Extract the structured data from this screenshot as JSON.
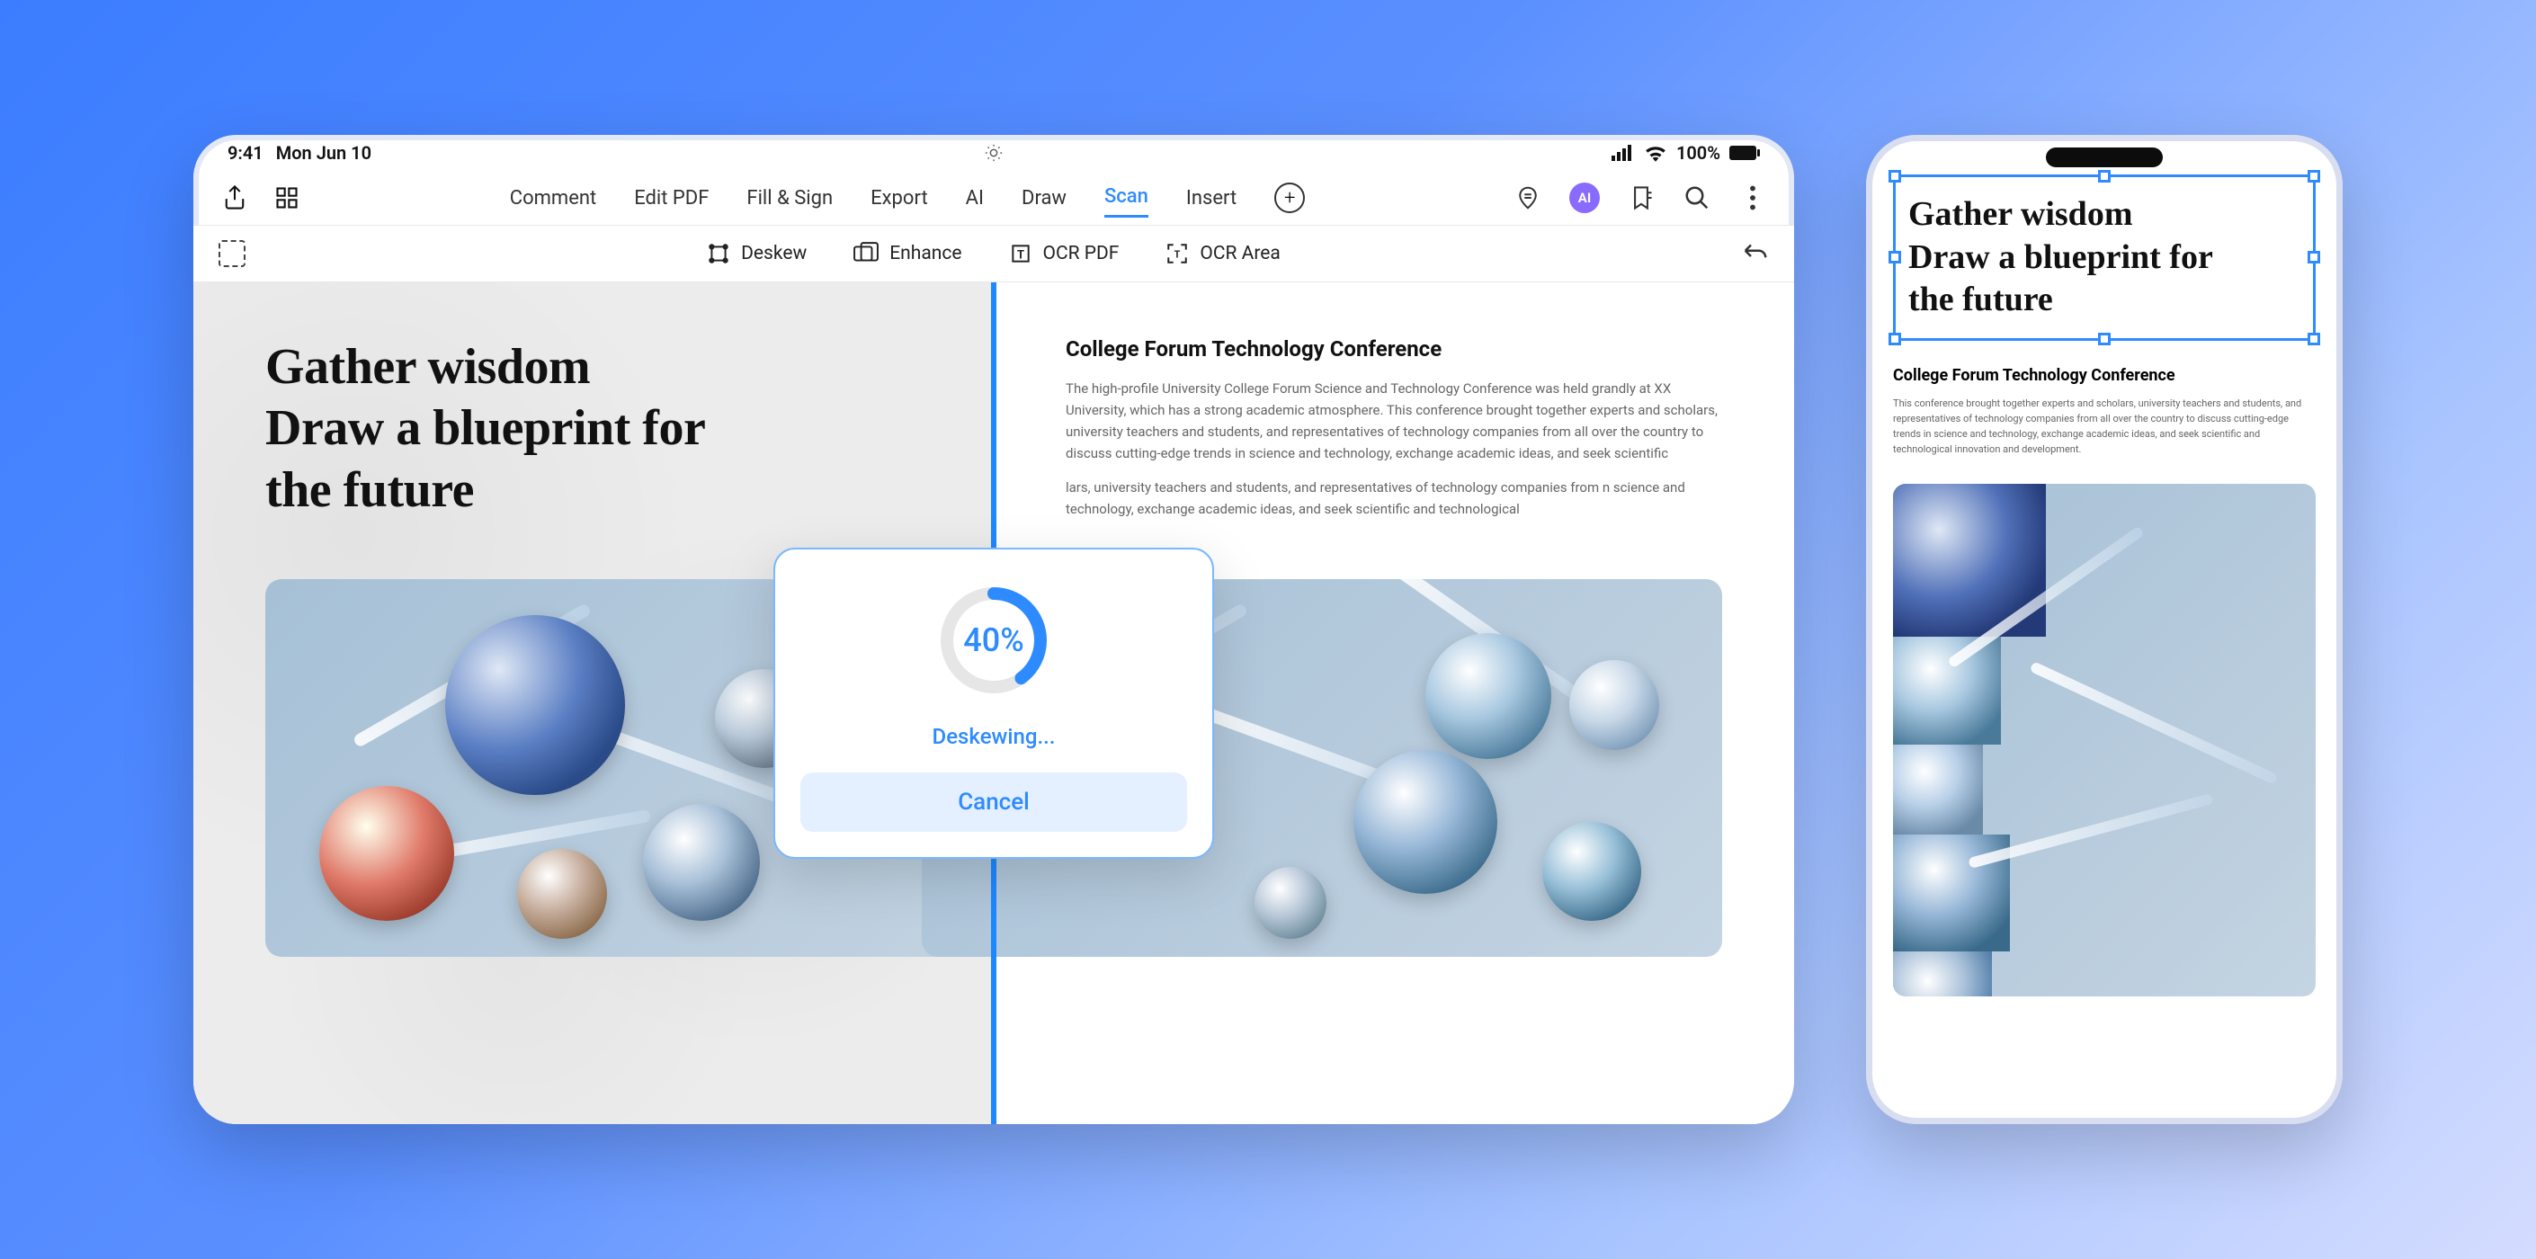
{
  "status_bar": {
    "time": "9:41",
    "date": "Mon Jun 10",
    "battery": "100%"
  },
  "toolbar": {
    "tabs": [
      "Comment",
      "Edit PDF",
      "Fill & Sign",
      "Export",
      "AI",
      "Draw",
      "Scan",
      "Insert"
    ],
    "active_tab": "Scan",
    "ai_badge": "AI"
  },
  "subtoolbar": {
    "deskew": "Deskew",
    "enhance": "Enhance",
    "ocr_pdf": "OCR PDF",
    "ocr_area": "OCR Area"
  },
  "document": {
    "title_line1": "Gather wisdom",
    "title_line2": "Draw a blueprint for",
    "title_line3": "the future",
    "heading": "College Forum Technology Conference",
    "para1": "The high-profile University College Forum Science and Technology Conference was held grandly at XX University, which has a strong academic atmosphere. This conference brought together experts and scholars, university teachers and students, and representatives of technology companies from all over the country to discuss cutting-edge trends in science and technology, exchange academic ideas, and seek scientific",
    "para2": "lars, university teachers and students, and representatives of technology companies from n science and technology, exchange academic ideas, and seek scientific and technological"
  },
  "modal": {
    "progress_pct": 40,
    "progress_label": "40%",
    "status": "Deskewing...",
    "cancel": "Cancel"
  },
  "phone": {
    "title_line1": "Gather wisdom",
    "title_line2": "Draw a blueprint for",
    "title_line3": "the future",
    "heading": "College Forum Technology Conference",
    "body": "This conference brought together experts and scholars, university teachers and students, and representatives of technology companies from all over the country to discuss cutting-edge trends in science and technology, exchange academic ideas, and seek scientific and technological innovation and development."
  }
}
